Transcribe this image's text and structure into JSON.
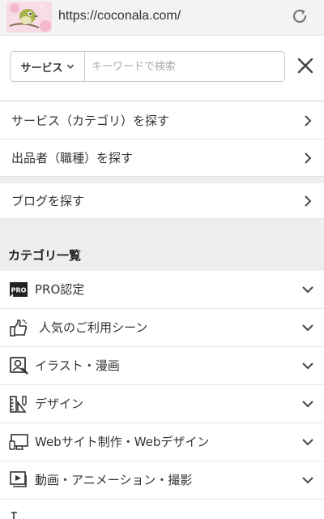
{
  "browser": {
    "url": "https://coconala.com/",
    "reload_icon": "reload-icon",
    "avatar_icon": "bird-avatar-icon"
  },
  "search": {
    "category_dropdown_label": "サービス",
    "placeholder": "キーワードで検索",
    "value": "",
    "close_icon": "close-icon"
  },
  "nav": {
    "items": [
      {
        "label": "サービス（カテゴリ）を探す"
      },
      {
        "label": "出品者（職種）を探す"
      },
      {
        "label": "ブログを探す"
      }
    ]
  },
  "categories": {
    "heading": "カテゴリ一覧",
    "items": [
      {
        "label": "PRO認定",
        "icon": "pro-badge-icon"
      },
      {
        "label": "人気のご利用シーン",
        "icon": "thumbs-up-icon"
      },
      {
        "label": "イラスト・漫画",
        "icon": "illustration-icon"
      },
      {
        "label": "デザイン",
        "icon": "design-ruler-icon"
      },
      {
        "label": "Webサイト制作・Webデザイン",
        "icon": "monitor-icon"
      },
      {
        "label": "動画・アニメーション・撮影",
        "icon": "video-icon"
      }
    ]
  },
  "colors": {
    "background_gap": "#eeeeee",
    "text": "#333333",
    "border": "#c8c8c8"
  }
}
